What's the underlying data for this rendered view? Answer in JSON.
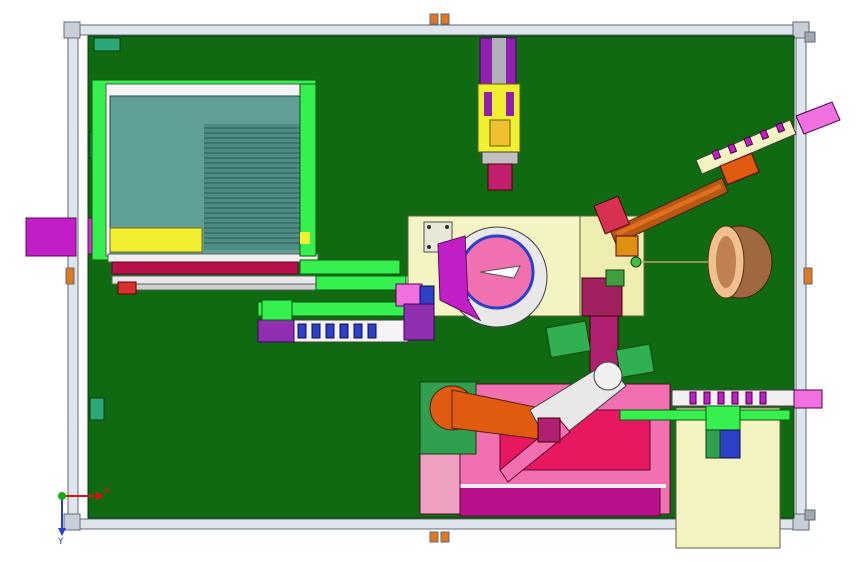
{
  "viewport": {
    "background": "#ffffff",
    "base_plate_color": "#0f6a12",
    "frame_color": "#d8dfe8"
  },
  "axis_triad": {
    "x_label": "X",
    "y_label": "Y",
    "x_color": "#e01010",
    "y_color": "#2040d0",
    "origin_color": "#10b010"
  },
  "palette": {
    "magenta": "#c21ec8",
    "teal": "#5f9f95",
    "lime": "#36f050",
    "yellow": "#f0f030",
    "cream": "#f4f4c2",
    "pink": "#f070b0",
    "crimson": "#b8104a",
    "orange": "#e05a10",
    "red": "#d83030",
    "blue": "#2c40c8",
    "purple": "#6a2aa8",
    "grey": "#909090"
  }
}
